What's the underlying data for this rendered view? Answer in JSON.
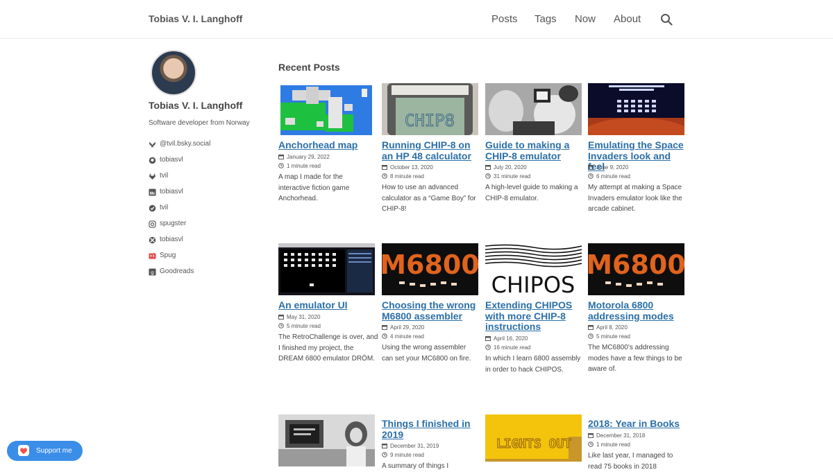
{
  "header": {
    "site_title": "Tobias V. I. Langhoff",
    "nav": [
      "Posts",
      "Tags",
      "Now",
      "About"
    ]
  },
  "sidebar": {
    "name": "Tobias V. I. Langhoff",
    "bio": "Software developer from Norway",
    "links": [
      {
        "icon": "bluesky-icon",
        "label": "@tvil.bsky.social"
      },
      {
        "icon": "github-icon",
        "label": "tobiasvl"
      },
      {
        "icon": "gitlab-icon",
        "label": "tvil"
      },
      {
        "icon": "linkedin-icon",
        "label": "tobiasvl"
      },
      {
        "icon": "keybase-icon",
        "label": "tvil"
      },
      {
        "icon": "instagram-icon",
        "label": "spugster"
      },
      {
        "icon": "xbox-icon",
        "label": "tobiasvl"
      },
      {
        "icon": "twitch-icon",
        "label": "Spug"
      },
      {
        "icon": "goodreads-icon",
        "label": "Goodreads"
      }
    ]
  },
  "main": {
    "section_title": "Recent Posts",
    "posts": [
      {
        "title": "Anchorhead map",
        "date": "January 29, 2022",
        "read": "1 minute read",
        "summary": "A map I made for the interactive fiction game Anchorhead."
      },
      {
        "title": "Running CHIP-8 on an HP 48 calculator",
        "date": "October 13, 2020",
        "read": "8 minute read",
        "summary": "How to use an advanced calculator as a “Game Boy” for CHIP-8!",
        "thumb_text": "CHIP8"
      },
      {
        "title": "Guide to making a CHIP-8 emulator",
        "date": "July 20, 2020",
        "read": "31 minute read",
        "summary": "A high-level guide to making a CHIP-8 emulator."
      },
      {
        "title": "Emulating the Space Invaders look and feel",
        "date": "June 9, 2020",
        "read": "6 minute read",
        "summary": "My attempt at making a Space Invaders emulator look like the arcade cabinet."
      },
      {
        "title": "An emulator UI",
        "date": "May 31, 2020",
        "read": "5 minute read",
        "summary": "The RetroChallenge is over, and I finished my project, the DREAM 6800 emulator DRÖM."
      },
      {
        "title": "Choosing the wrong M6800 assembler",
        "date": "April 29, 2020",
        "read": "4 minute read",
        "summary": "Using the wrong assembler can set your MC6800 on fire.",
        "thumb_text": "M6800"
      },
      {
        "title": "Extending CHIPOS with more CHIP-8 instructions",
        "date": "April 16, 2020",
        "read": "16 minute read",
        "summary": "In which I learn 6800 assembly in order to hack CHIPOS.",
        "thumb_text": "CHIPOS"
      },
      {
        "title": "Motorola 6800 addressing modes",
        "date": "April 8, 2020",
        "read": "5 minute read",
        "summary": "The MC6800’s addressing modes have a few things to be aware of.",
        "thumb_text": "M6800"
      },
      {
        "title": "Things I finished in 2019",
        "date": "December 31, 2019",
        "read": "9 minute read",
        "summary": "A summary of things I"
      },
      {
        "title": "",
        "date": "",
        "read": "",
        "summary": "",
        "thumb_text": "LIGHTS OUT"
      },
      {
        "title": "2018: Year in Books",
        "date": "December 31, 2018",
        "read": "1 minute read",
        "summary": "Like last year, I managed to read 75 books in 2018"
      }
    ]
  },
  "support_button": {
    "label": "Support me",
    "icon": "kofi-icon"
  },
  "colors": {
    "link": "#2a6fa8",
    "support_bg": "#3a8ee8"
  }
}
